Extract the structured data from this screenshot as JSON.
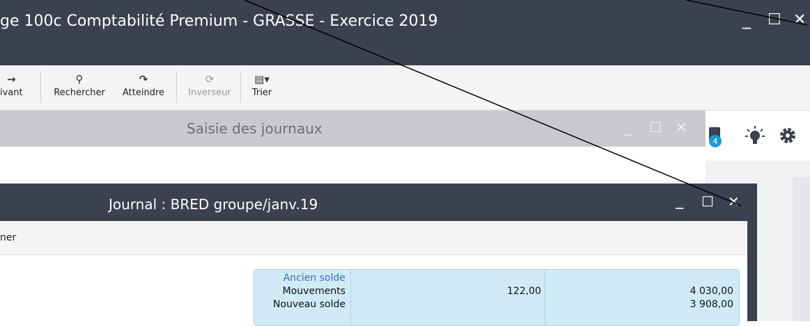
{
  "window": {
    "title": "ge 100c Comptabilité Premium - GRASSE - Exercice 2019",
    "minimize": "_",
    "maximize": "☐",
    "close": "✕"
  },
  "toolbar": {
    "items": [
      {
        "label": "ivant",
        "icon": "arrow-right-icon",
        "glyph": "→",
        "enabled": true
      },
      {
        "label": "Rechercher",
        "icon": "search-icon",
        "glyph": "⚲",
        "enabled": true
      },
      {
        "label": "Atteindre",
        "icon": "redo-arrow-icon",
        "glyph": "↷",
        "enabled": true
      },
      {
        "label": "Inverseur",
        "icon": "refresh-icon",
        "glyph": "⟳",
        "enabled": false
      },
      {
        "label": "Trier",
        "icon": "sort-list-icon",
        "glyph": "▤▾",
        "enabled": true
      }
    ]
  },
  "saisie": {
    "title": "Saisie des journaux",
    "minimize": "_",
    "maximize": "☐",
    "close": "✕"
  },
  "right_panel": {
    "badge": "4",
    "icons": [
      "notification-icon",
      "lightbulb-icon",
      "gear-icon"
    ]
  },
  "journal": {
    "title": "Journal : BRED groupe/janv.19",
    "minimize": "_",
    "maximize": "☐",
    "close": "✕",
    "toolbar_text": "ner",
    "totals": {
      "rows": [
        {
          "label": "Ancien solde",
          "col1": "",
          "col2": ""
        },
        {
          "label": "Mouvements",
          "col1": "122,00",
          "col2": "4 030,00"
        },
        {
          "label": "Nouveau solde",
          "col1": "",
          "col2": "3 908,00"
        }
      ]
    }
  },
  "colors": {
    "titlebar": "#3b4150",
    "totals_bg": "#d0ebf6",
    "ancien_solde": "#3a6fc4",
    "badge": "#1a9ad6"
  }
}
